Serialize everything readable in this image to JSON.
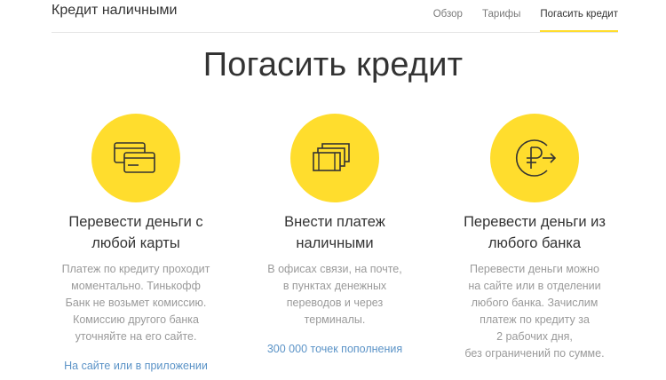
{
  "header": {
    "brand": "Кредит наличными",
    "nav": [
      {
        "label": "Обзор",
        "active": false
      },
      {
        "label": "Тарифы",
        "active": false
      },
      {
        "label": "Погасить кредит",
        "active": true
      }
    ]
  },
  "page": {
    "title": "Погасить кредит"
  },
  "columns": [
    {
      "icon": "cards-icon",
      "heading_1": "Перевести деньги с",
      "heading_2": "любой карты",
      "text_lines": [
        "Платеж по кредиту проходит",
        "моментально. Тинькофф",
        "Банк не возьмет комиссию.",
        "Комиссию другого банка",
        "уточняйте на его сайте."
      ],
      "link_site": "На сайте",
      "link_or": "или",
      "link_app": "в приложении"
    },
    {
      "icon": "cash-bills-icon",
      "heading_1": "Внести платеж",
      "heading_2": "наличными",
      "text_lines": [
        "В офисах связи, на почте,",
        "в пунктах денежных",
        "переводов и через",
        "терминалы."
      ],
      "link": "300 000 точек пополнения"
    },
    {
      "icon": "ruble-transfer-icon",
      "heading_1": "Перевести деньги из",
      "heading_2": "любого банка",
      "text_lines": [
        "Перевести деньги можно",
        "на сайте или в отделении",
        "любого банка. Зачислим",
        "платеж по кредиту за",
        "2 рабочих дня,",
        "без ограничений по сумме."
      ]
    }
  ],
  "colors": {
    "accent": "#ffdd2d",
    "link": "#5b93c7",
    "muted": "#9a9a9a"
  }
}
